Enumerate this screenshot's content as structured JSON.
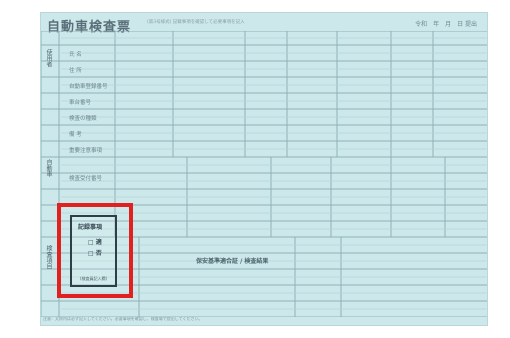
{
  "document": {
    "title": "自動車検査票",
    "subtitle": "(第3号様式) 記載事項を確認して必要事項を記入",
    "date_label": "令和　年　月　日 提出",
    "section_owner": "使用者",
    "section_vehicle": "自動車",
    "section_check": "検査項目",
    "box_label_1": "氏 名",
    "box_label_2": "住 所",
    "box_label_3": "自動車登録番号",
    "box_label_4": "車台番号",
    "box_label_5": "検査の種類",
    "box_label_6": "備 考",
    "box_label_7": "重要注意事項",
    "box_label_8": "検査受付番号",
    "focus_text": "保安基準適合証 / 検査結果",
    "stamp": {
      "heading": "記録事項",
      "option_1": "□ 適",
      "option_2": "□ 否",
      "note": "(検査員記入欄)"
    },
    "footer": "注意：太枠内は必ず記入してください。必要事項を確認し、検査場で提出してください。"
  },
  "colors": {
    "highlight": "#e12020",
    "paper": "#cce8ea"
  }
}
